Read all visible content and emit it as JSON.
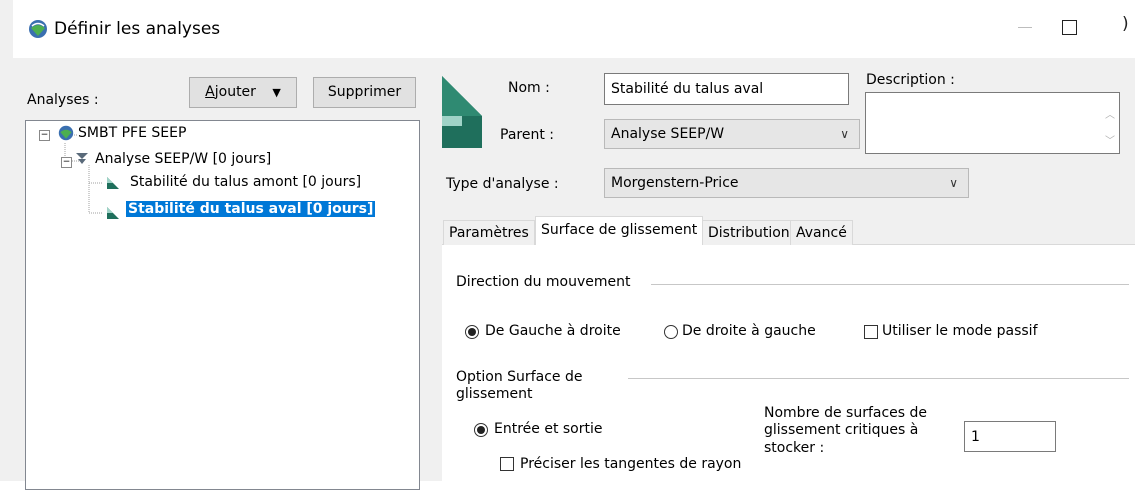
{
  "window": {
    "title": "Définir les analyses"
  },
  "left_panel": {
    "analyses_label": "Analyses :",
    "add_button": "Ajouter",
    "add_button_mnemonic": "A",
    "add_button_rest": "jouter",
    "delete_button": "Supprimer",
    "tree": [
      {
        "label": "SMBT PFE SEEP",
        "toggle": "−"
      },
      {
        "label": "Analyse SEEP/W [0 jours]",
        "toggle": "−"
      },
      {
        "label": "Stabilité du talus amont [0 jours]"
      },
      {
        "label": "Stabilité du talus aval [0 jours]",
        "selected": true
      }
    ]
  },
  "form": {
    "name_label": "Nom :",
    "name_value": "Stabilité du talus aval",
    "description_label": "Description :",
    "description_value": "",
    "parent_label": "Parent :",
    "parent_value": "Analyse SEEP/W",
    "type_label": "Type d'analyse :",
    "type_value": "Morgenstern-Price"
  },
  "tabs": [
    {
      "label": "Paramètres",
      "active": false
    },
    {
      "label": "Surface de glissement",
      "active": true
    },
    {
      "label": "Distribution",
      "active": false
    },
    {
      "label": "Avancé",
      "active": false
    }
  ],
  "slip_surface": {
    "direction_heading": "Direction du mouvement",
    "left_to_right": "De Gauche à droite",
    "right_to_left": "De droite à gauche",
    "passive_mode": "Utiliser le mode passif",
    "option_heading_line1": "Option Surface de",
    "option_heading_line2": "glissement",
    "entry_exit": "Entrée et sortie",
    "tangent_radius": "Préciser les tangentes de rayon",
    "critical_count_label_line1": "Nombre de surfaces de",
    "critical_count_label_line2": "glissement critiques à",
    "critical_count_label_line3": "stocker :",
    "critical_count_value": "1"
  },
  "colors": {
    "selection": "#0078d7",
    "dialog_bg": "#f0f0f0",
    "slope_icon_light": "#9fd3c7",
    "slope_icon_dark": "#1f6f5c"
  }
}
